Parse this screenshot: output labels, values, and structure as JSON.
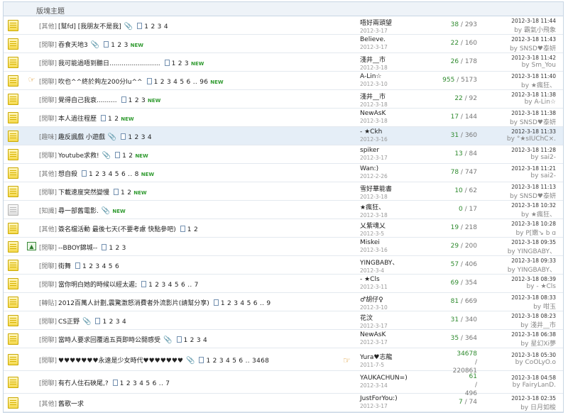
{
  "header": {
    "title": "版塊主題"
  },
  "threads": [
    {
      "tag": "[其他]",
      "subject": "[幫fd] [我朋友不是我]",
      "attach": true,
      "pages": "1 2 3 4",
      "new": "",
      "author": "唔好兩頭望",
      "date": "2012-3-17",
      "replies": "38",
      "views": "293",
      "last_date": "2012-3-18 11:44",
      "last_by": "by 霸氣小飛象",
      "icon": "folder"
    },
    {
      "tag": "[閒聊]",
      "subject": "吞食天地3",
      "attach": true,
      "pages": "1 2 3",
      "new": "NEW",
      "author": "Believe.",
      "date": "2012-3-17",
      "replies": "22",
      "views": "160",
      "last_date": "2012-3-18 11:43",
      "last_by": "by SNSD♥泰妍",
      "icon": "folder"
    },
    {
      "tag": "[閒聊]",
      "subject": "我可能過唔到聽日.........................",
      "attach": false,
      "pages": "1 2 3",
      "new": "NEW",
      "author": "淺井__市",
      "date": "2012-3-18",
      "replies": "26",
      "views": "178",
      "last_date": "2012-3-18 11:42",
      "last_by": "by Sm_You",
      "icon": "folder"
    },
    {
      "tag": "[閒聊]",
      "subject": "吹也^^終於夠左200分lu^^",
      "attach": false,
      "pages": "1 2 3 4 5 6 .. 96",
      "new": "NEW",
      "author": "A-Lin☆",
      "date": "2012-3-10",
      "replies": "955",
      "views": "5173",
      "last_date": "2012-3-18 11:40",
      "last_by": "by ★瘋狂、",
      "icon": "folder",
      "type_icon": "thumb"
    },
    {
      "tag": "[閒聊]",
      "subject": "覺得自己我衰..........",
      "attach": false,
      "pages": "1 2 3",
      "new": "NEW",
      "author": "淺井__市",
      "date": "2012-3-18",
      "replies": "22",
      "views": "92",
      "last_date": "2012-3-18 11:38",
      "last_by": "by A-Lin☆",
      "icon": "folder"
    },
    {
      "tag": "[閒聊]",
      "subject": "本人過往程歷",
      "attach": false,
      "pages": "1 2",
      "new": "NEW",
      "author": "NewAsK",
      "date": "2012-3-18",
      "replies": "17",
      "views": "144",
      "last_date": "2012-3-18 11:38",
      "last_by": "by SNSD♥泰妍",
      "icon": "folder"
    },
    {
      "tag": "[趣味]",
      "subject": "趣反諷戲 小遊戲",
      "attach": true,
      "pages": "1 2 3 4",
      "new": "",
      "author": "- ★Ckh",
      "date": "2012-3-16",
      "replies": "31",
      "views": "360",
      "last_date": "2012-3-18 11:33",
      "last_by": "by °★sIUChC×.",
      "icon": "folder",
      "highlight": true
    },
    {
      "tag": "[閒聊]",
      "subject": "Youtube求救!",
      "attach": true,
      "pages": "1 2",
      "new": "NEW",
      "author": "spiker",
      "date": "2012-3-17",
      "replies": "13",
      "views": "84",
      "last_date": "2012-3-18 11:28",
      "last_by": "by sai2-",
      "icon": "folder"
    },
    {
      "tag": "[其他]",
      "subject": "想自殺",
      "attach": false,
      "pages": "1 2 3 4 5 6 .. 8",
      "new": "NEW",
      "author": "Wan:)",
      "date": "2012-2-26",
      "replies": "78",
      "views": "747",
      "last_date": "2012-3-18 11:21",
      "last_by": "by sai2-",
      "icon": "folder"
    },
    {
      "tag": "[閒聊]",
      "subject": "下載速度突然變慢",
      "attach": false,
      "pages": "1 2",
      "new": "NEW",
      "author": "雪好華能書",
      "date": "2012-3-18",
      "replies": "10",
      "views": "62",
      "last_date": "2012-3-18 11:13",
      "last_by": "by SNSD♥泰妍",
      "icon": "folder"
    },
    {
      "tag": "[知識]",
      "subject": "尋一部舊電影.",
      "attach": true,
      "pages": "",
      "new": "NEW",
      "author": "★瘋狂、",
      "date": "2012-3-18",
      "replies": "0",
      "views": "17",
      "last_date": "2012-3-18 10:32",
      "last_by": "by ★瘋狂、",
      "icon": "grey"
    },
    {
      "tag": "[其他]",
      "subject": "簽名檔活動 最後七天(不要考慮 快點參吧)",
      "attach": false,
      "pages": "1 2",
      "new": "",
      "author": "乂紫魂乂",
      "date": "2012-3-5",
      "replies": "19",
      "views": "218",
      "last_date": "2012-3-18 10:28",
      "last_by": "by P[嫩↘ b ɑ",
      "icon": "folder"
    },
    {
      "tag": "[閒聊]",
      "subject": "--BBOY錦城--",
      "attach": false,
      "pages": "1 2 3",
      "new": "",
      "author": "Miskei",
      "date": "2012-3-16",
      "replies": "29",
      "views": "200",
      "last_date": "2012-3-18 09:35",
      "last_by": "by YINGBABY、",
      "icon": "folder",
      "type_icon": "img"
    },
    {
      "tag": "[閒聊]",
      "subject": "街舞",
      "attach": false,
      "pages": "1 2 3 4 5 6",
      "new": "",
      "author": "YINGBABY、",
      "date": "2012-3-4",
      "replies": "57",
      "views": "406",
      "last_date": "2012-3-18 09:33",
      "last_by": "by YINGBABY、",
      "icon": "folder"
    },
    {
      "tag": "[閒聊]",
      "subject": "當你明白她的時候以經太遲;",
      "attach": false,
      "pages": "1 2 3 4 5 6 .. 7",
      "new": "",
      "author": "- ★Cls",
      "date": "2012-3-11",
      "replies": "69",
      "views": "354",
      "last_date": "2012-3-18 08:39",
      "last_by": "by - ★Cls",
      "icon": "folder"
    },
    {
      "tag": "[轉貼]",
      "subject": "2012百萬人計劃,震驚激怒消費者外流影片(請幫分享)",
      "attach": false,
      "pages": "1 2 3 4 5 6 .. 9",
      "new": "",
      "author": "♂胡仔♀",
      "date": "2012-3-10",
      "replies": "81",
      "views": "669",
      "last_date": "2012-3-18 08:33",
      "last_by": "by 咁玉",
      "icon": "folder"
    },
    {
      "tag": "[閒聊]",
      "subject": "CS正野",
      "attach": true,
      "pages": "1 2 3 4",
      "new": "",
      "author": "花汶",
      "date": "2012-3-17",
      "replies": "31",
      "views": "340",
      "last_date": "2012-3-18 08:23",
      "last_by": "by 淺井__市",
      "icon": "folder"
    },
    {
      "tag": "[閒聊]",
      "subject": "當時人要求回覆過五頁即時公開感受",
      "attach": true,
      "pages": "1 2 3 4",
      "new": "",
      "author": "NewAsK",
      "date": "2012-3-17",
      "replies": "35",
      "views": "364",
      "last_date": "2012-3-18 06:38",
      "last_by": "by 星幻Xi夢",
      "icon": "folder"
    },
    {
      "tag": "[閒聊]",
      "subject": "♥♥♥♥♥♥♥永遠是少女時代♥♥♥♥♥♥♥",
      "attach": true,
      "pages": "1 2 3 4 5 6 .. 3468",
      "new": "",
      "author": "Yura♥志龍",
      "date": "2011-7-5",
      "replies": "34678",
      "views": "220861",
      "last_date": "2012-3-18 05:30",
      "last_by": "by CoOLyO.o",
      "icon": "folder",
      "tall": true,
      "thumb": true
    },
    {
      "tag": "[閒聊]",
      "subject": "有冇人住石硤尾,?",
      "attach": false,
      "pages": "1 2 3 4 5 6 .. 7",
      "new": "",
      "author": "YAUKACHUN=)",
      "date": "2012-3-14",
      "replies": "61",
      "views": "496",
      "last_date": "2012-3-18 04:58",
      "last_by": "by FairyLanD.",
      "icon": "folder",
      "tall": true
    },
    {
      "tag": "[其他]",
      "subject": "舊歌一求",
      "attach": false,
      "pages": "",
      "new": "",
      "author": "JustForYou:)",
      "date": "2012-3-17",
      "replies": "7",
      "views": "74",
      "last_date": "2012-3-18 02:35",
      "last_by": "by 日月如梭",
      "icon": "folder"
    }
  ]
}
